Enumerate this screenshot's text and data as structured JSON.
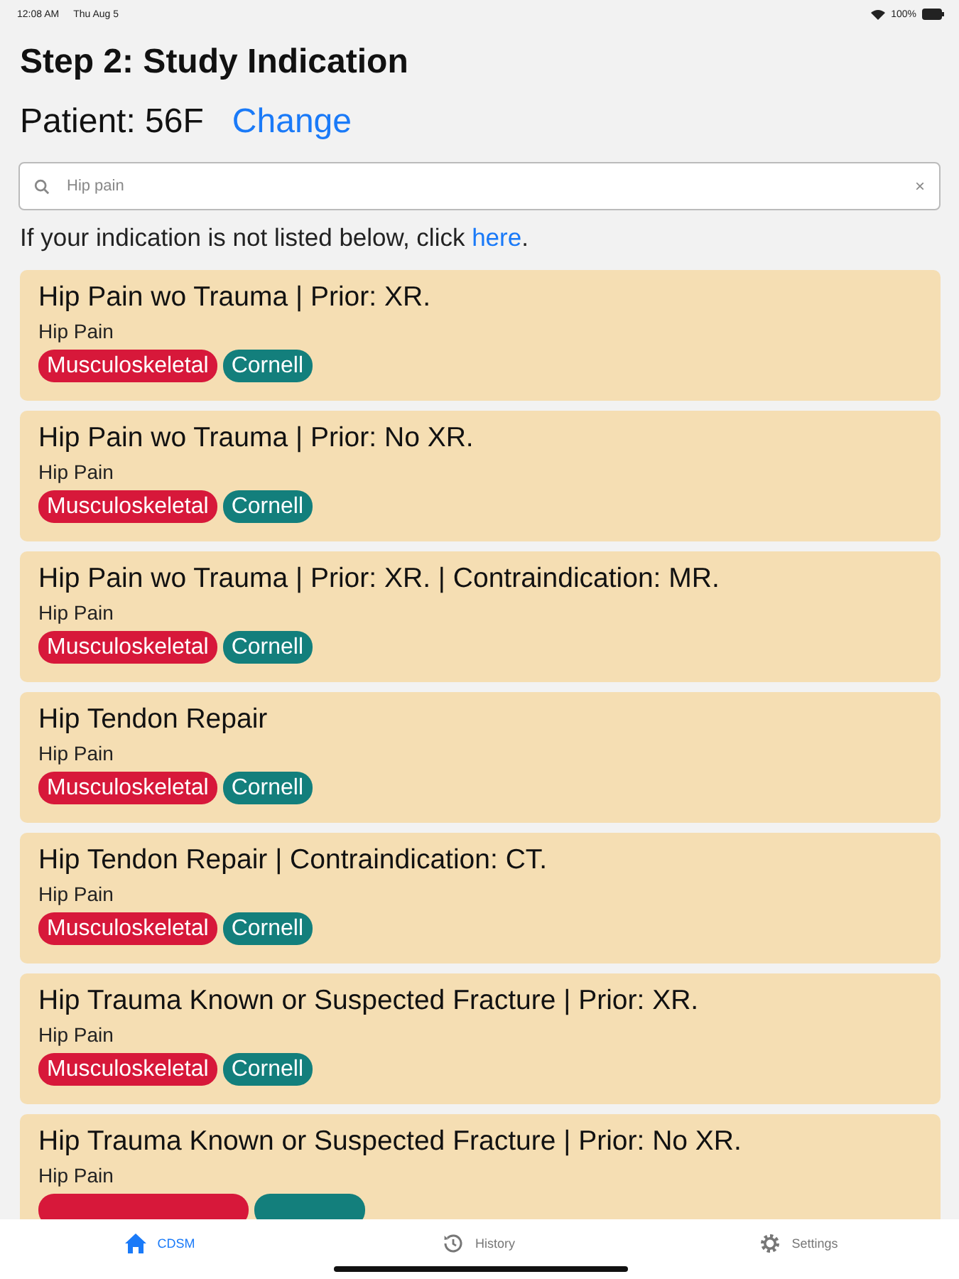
{
  "status_bar": {
    "time": "12:08 AM",
    "date": "Thu Aug 5",
    "battery": "100%"
  },
  "title": "Step 2: Study Indication",
  "patient": {
    "label": "Patient: 56F",
    "action": "Change"
  },
  "search": {
    "value": "Hip pain",
    "clear": "×"
  },
  "hint": {
    "text": "If your indication is not listed below, click ",
    "link": "here",
    "end": "."
  },
  "indications": [
    {
      "title": "Hip Pain wo Trauma | Prior: XR.",
      "subtitle": "Hip Pain",
      "tags": [
        {
          "label": "Musculoskeletal",
          "color": "#d7183a"
        },
        {
          "label": "Cornell",
          "color": "#137f7c"
        }
      ]
    },
    {
      "title": "Hip Pain wo Trauma | Prior: No XR.",
      "subtitle": "Hip Pain",
      "tags": [
        {
          "label": "Musculoskeletal",
          "color": "#d7183a"
        },
        {
          "label": "Cornell",
          "color": "#137f7c"
        }
      ]
    },
    {
      "title": "Hip Pain wo Trauma | Prior: XR. | Contraindication: MR.",
      "subtitle": "Hip Pain",
      "tags": [
        {
          "label": "Musculoskeletal",
          "color": "#d7183a"
        },
        {
          "label": "Cornell",
          "color": "#137f7c"
        }
      ]
    },
    {
      "title": "Hip Tendon Repair",
      "subtitle": "Hip Pain",
      "tags": [
        {
          "label": "Musculoskeletal",
          "color": "#d7183a"
        },
        {
          "label": "Cornell",
          "color": "#137f7c"
        }
      ]
    },
    {
      "title": "Hip Tendon Repair | Contraindication: CT.",
      "subtitle": "Hip Pain",
      "tags": [
        {
          "label": "Musculoskeletal",
          "color": "#d7183a"
        },
        {
          "label": "Cornell",
          "color": "#137f7c"
        }
      ]
    },
    {
      "title": "Hip Trauma Known or Suspected Fracture | Prior: XR.",
      "subtitle": "Hip Pain",
      "tags": [
        {
          "label": "Musculoskeletal",
          "color": "#d7183a"
        },
        {
          "label": "Cornell",
          "color": "#137f7c"
        }
      ]
    },
    {
      "title": "Hip Trauma Known or Suspected Fracture | Prior: No XR.",
      "subtitle": "Hip Pain"
    }
  ],
  "tab_bar": [
    {
      "label": "CDSM",
      "kind": "home",
      "selected": true
    },
    {
      "label": "History",
      "kind": "history",
      "selected": false
    },
    {
      "label": "Settings",
      "kind": "gear",
      "selected": false
    }
  ]
}
